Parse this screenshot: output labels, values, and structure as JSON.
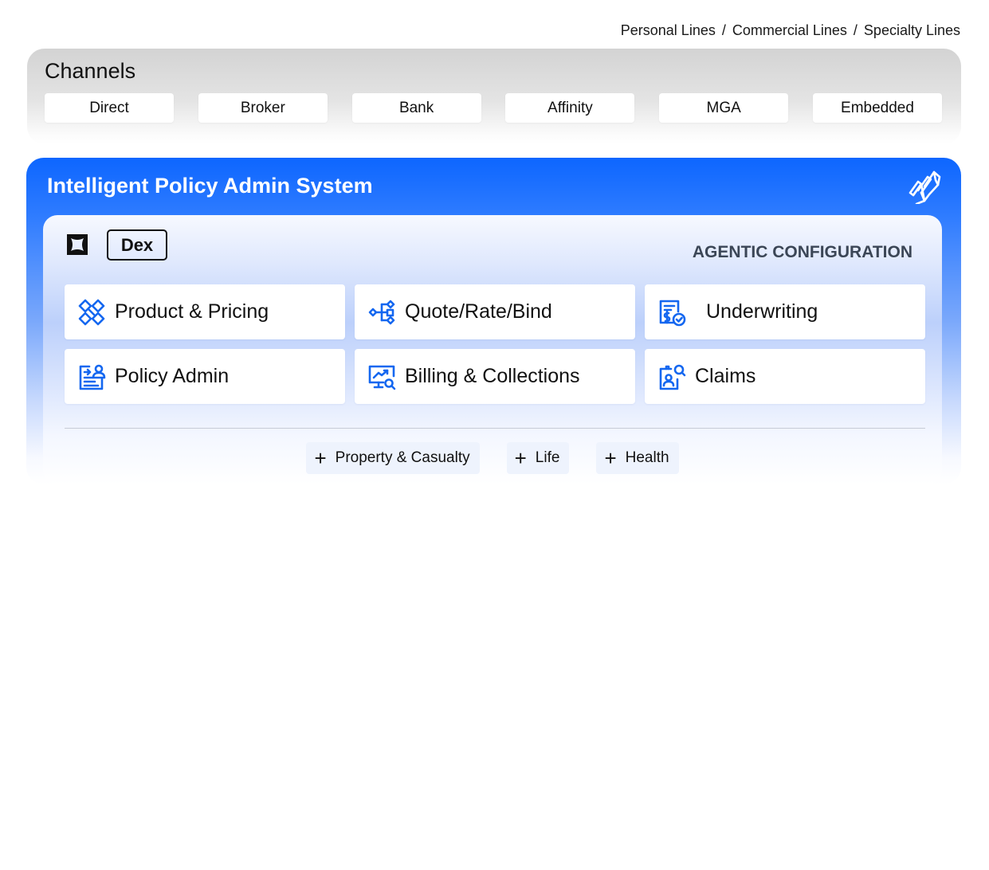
{
  "breadcrumb": {
    "items": [
      "Personal Lines",
      "Commercial Lines",
      "Specialty Lines"
    ],
    "separator": "/"
  },
  "channels": {
    "title": "Channels",
    "items": [
      "Direct",
      "Broker",
      "Bank",
      "Affinity",
      "MGA",
      "Embedded"
    ]
  },
  "system": {
    "title": "Intelligent Policy Admin System",
    "brand_icon": "stacked-layers-icon",
    "dex_label": "Dex",
    "agentic_label": "AGENTIC CONFIGURATION",
    "modules": [
      {
        "label": "Product & Pricing",
        "icon": "puzzle-diamond-icon"
      },
      {
        "label": "Quote/Rate/Bind",
        "icon": "flow-nodes-icon"
      },
      {
        "label": "Underwriting",
        "icon": "document-dollar-check-icon"
      },
      {
        "label": "Policy Admin",
        "icon": "document-person-icon"
      },
      {
        "label": "Billing & Collections",
        "icon": "monitor-chart-search-icon"
      },
      {
        "label": "Claims",
        "icon": "badge-search-icon"
      }
    ],
    "lines_of_business": [
      "Property & Casualty",
      "Life",
      "Health"
    ]
  },
  "colors": {
    "accent": "#0d66ff",
    "icon_blue": "#1467f0",
    "channel_bg": "#d3d3d3",
    "lob_chip_bg": "#eef3fd"
  }
}
